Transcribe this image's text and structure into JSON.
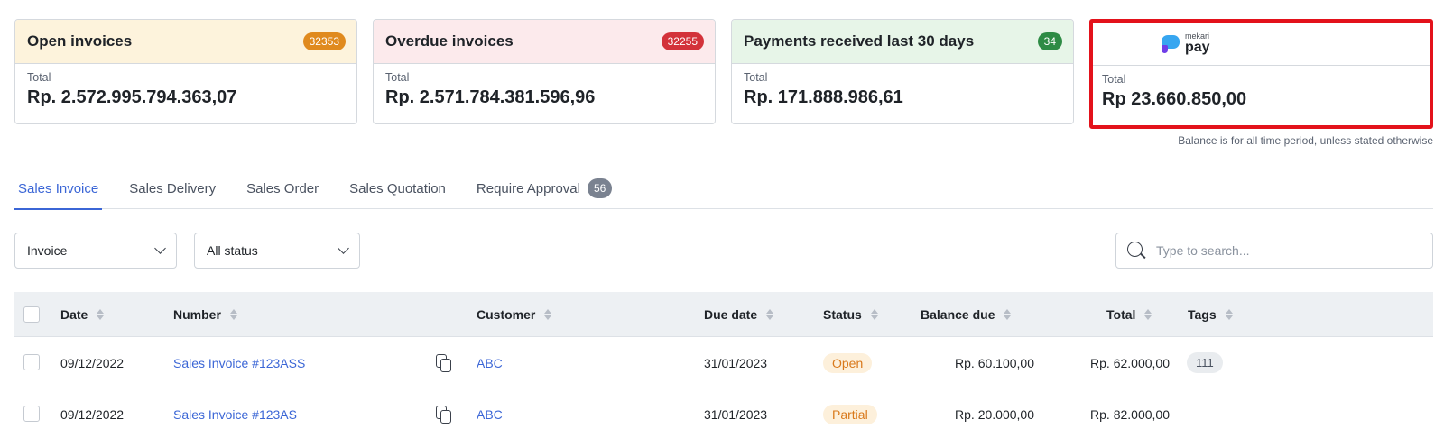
{
  "cards": [
    {
      "title": "Open invoices",
      "count": "32353",
      "sub": "Total",
      "amount": "Rp. 2.572.995.794.363,07"
    },
    {
      "title": "Overdue invoices",
      "count": "32255",
      "sub": "Total",
      "amount": "Rp. 2.571.784.381.596,96"
    },
    {
      "title": "Payments received last 30 days",
      "count": "34",
      "sub": "Total",
      "amount": "Rp. 171.888.986,61"
    }
  ],
  "mekari_pay": {
    "logo_small": "mekari",
    "logo_big": "pay",
    "sub": "Total",
    "amount": "Rp 23.660.850,00"
  },
  "balance_note": "Balance is for all time period, unless stated otherwise",
  "tabs": [
    {
      "label": "Sales Invoice"
    },
    {
      "label": "Sales Delivery"
    },
    {
      "label": "Sales Order"
    },
    {
      "label": "Sales Quotation"
    },
    {
      "label": "Require Approval",
      "count": "56"
    }
  ],
  "filters": {
    "type": "Invoice",
    "status": "All status"
  },
  "search": {
    "placeholder": "Type to search..."
  },
  "table": {
    "headers": {
      "date": "Date",
      "number": "Number",
      "customer": "Customer",
      "due_date": "Due date",
      "status": "Status",
      "balance_due": "Balance due",
      "total": "Total",
      "tags": "Tags"
    },
    "rows": [
      {
        "date": "09/12/2022",
        "number": "Sales Invoice #123ASS",
        "customer": "ABC",
        "due_date": "31/01/2023",
        "status": "Open",
        "balance_due": "Rp. 60.100,00",
        "total": "Rp. 62.000,00",
        "tag": "111"
      },
      {
        "date": "09/12/2022",
        "number": "Sales Invoice #123AS",
        "customer": "ABC",
        "due_date": "31/01/2023",
        "status": "Partial",
        "balance_due": "Rp. 20.000,00",
        "total": "Rp. 82.000,00",
        "tag": ""
      }
    ]
  }
}
